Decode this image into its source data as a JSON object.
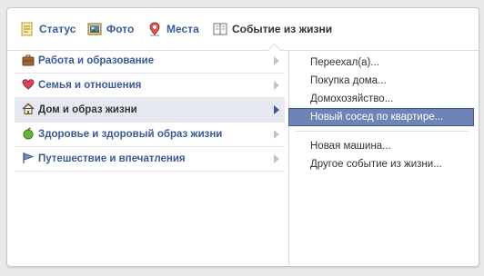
{
  "tabs": [
    {
      "label": "Статус",
      "icon": "status-icon"
    },
    {
      "label": "Фото",
      "icon": "photo-icon"
    },
    {
      "label": "Места",
      "icon": "place-pin-icon"
    },
    {
      "label": "Событие из жизни",
      "icon": "life-event-book-icon"
    }
  ],
  "categories": [
    {
      "label": "Работа и образование",
      "icon": "briefcase-icon"
    },
    {
      "label": "Семья и отношения",
      "icon": "heart-icon"
    },
    {
      "label": "Дом и образ жизни",
      "icon": "house-icon",
      "selected": true
    },
    {
      "label": "Здоровье и здоровый образ жизни",
      "icon": "apple-icon"
    },
    {
      "label": "Путешествие и впечатления",
      "icon": "flag-icon"
    }
  ],
  "submenu": {
    "group1": [
      "Переехал(а)...",
      "Покупка дома...",
      "Домохозяйство...",
      "Новый сосед по квартире..."
    ],
    "group2": [
      "Новая машина...",
      "Другое событие из жизни..."
    ],
    "highlighted": "Новый сосед по квартире..."
  },
  "colors": {
    "link": "#3b5998",
    "highlight": "#6d84b4",
    "selected_row": "#e6e9f0"
  }
}
